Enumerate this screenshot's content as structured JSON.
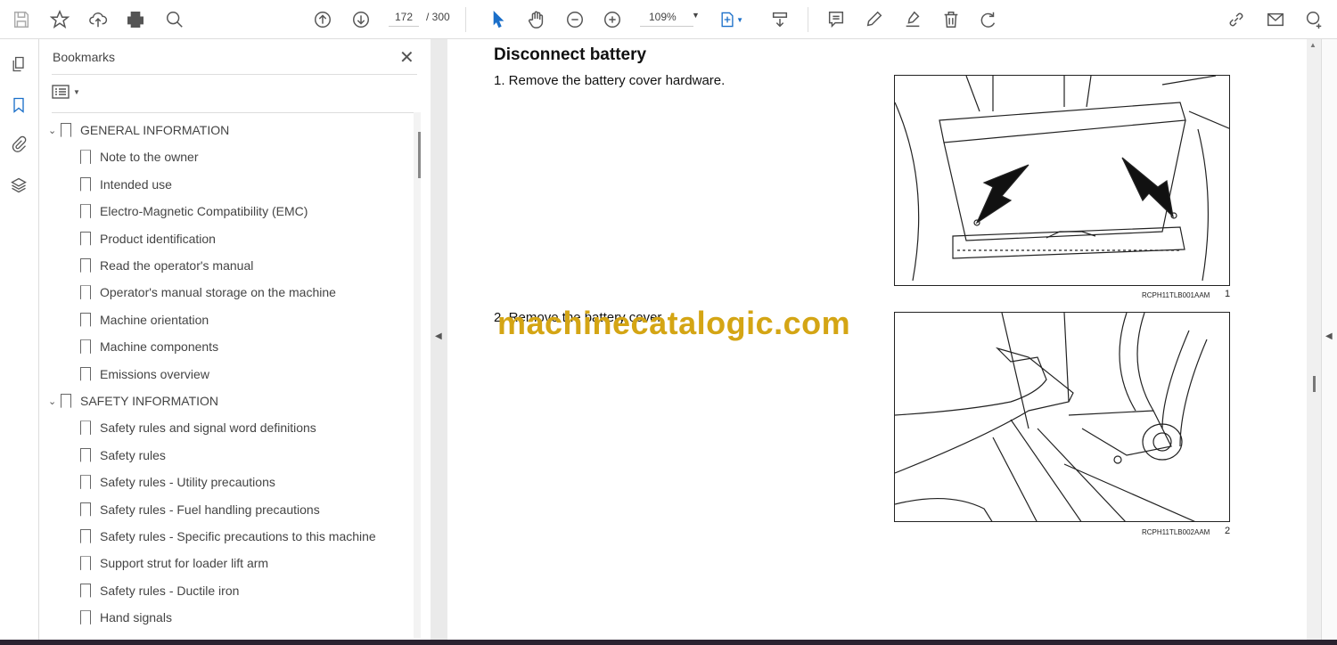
{
  "toolbar": {
    "page_current": "172",
    "page_total": "/ 300",
    "zoom": "109%"
  },
  "bookmarks": {
    "title": "Bookmarks",
    "sections": [
      {
        "label": "GENERAL INFORMATION",
        "items": [
          "Note to the owner",
          "Intended use",
          "Electro-Magnetic Compatibility (EMC)",
          "Product identification",
          "Read the operator's manual",
          "Operator's manual storage on the machine",
          "Machine orientation",
          "Machine components",
          "Emissions overview"
        ]
      },
      {
        "label": "SAFETY INFORMATION",
        "items": [
          "Safety rules and signal word definitions",
          "Safety rules",
          "Safety rules - Utility precautions",
          "Safety rules - Fuel handling precautions",
          "Safety rules - Specific precautions to this machine",
          "Support strut for loader lift arm",
          "Safety rules - Ductile iron",
          "Hand signals"
        ]
      }
    ]
  },
  "document": {
    "heading": "Disconnect battery",
    "steps": [
      "1.  Remove the battery cover hardware.",
      "2.  Remove the battery cover."
    ],
    "figures": [
      {
        "code": "RCPH11TLB001AAM",
        "number": "1"
      },
      {
        "code": "RCPH11TLB002AAM",
        "number": "2"
      }
    ],
    "watermark": "machinecatalogic.com"
  }
}
